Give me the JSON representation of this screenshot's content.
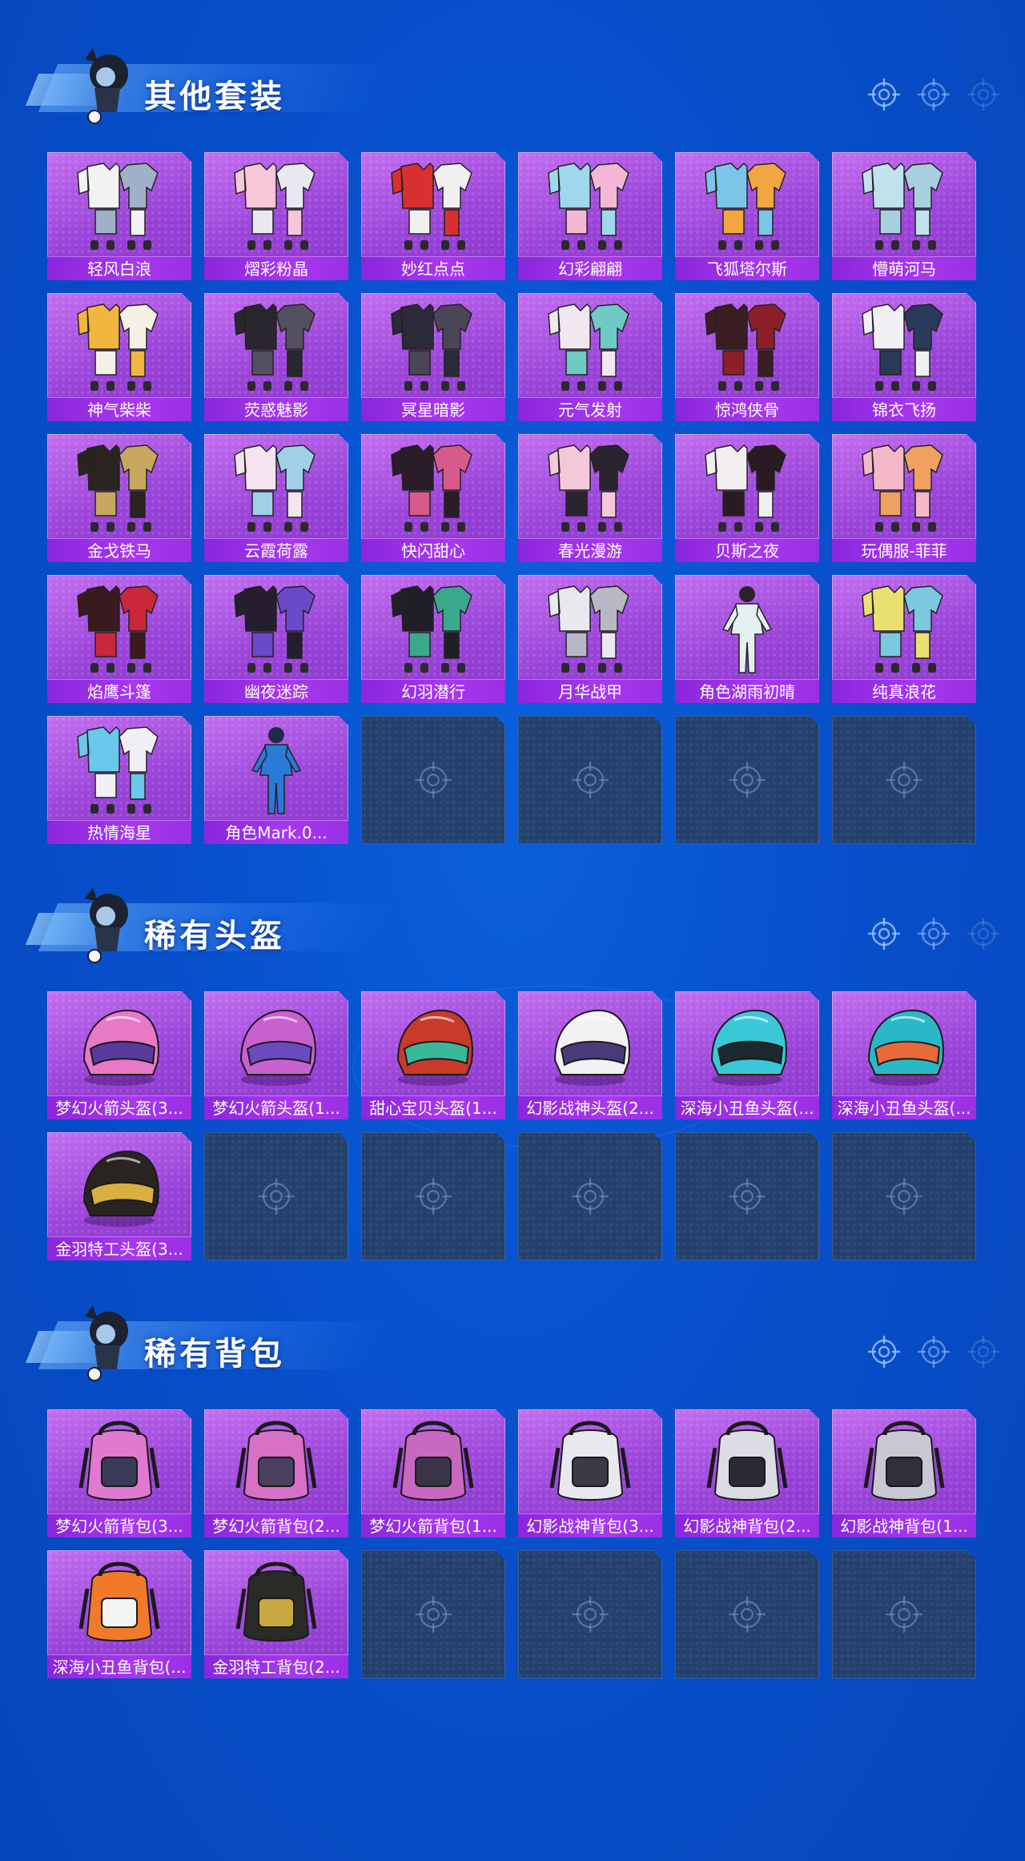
{
  "sections": [
    {
      "title": "其他套装",
      "icon": "suit-icon",
      "items": [
        {
          "name": "轻风白浪",
          "kind": "outfit",
          "colors": [
            "#f2f2f2",
            "#9fb0c8"
          ]
        },
        {
          "name": "熠彩粉晶",
          "kind": "outfit",
          "colors": [
            "#f7c6d9",
            "#e8e8f0"
          ]
        },
        {
          "name": "妙红点点",
          "kind": "outfit",
          "colors": [
            "#d83030",
            "#f0f0f0"
          ]
        },
        {
          "name": "幻彩翩翩",
          "kind": "outfit",
          "colors": [
            "#9fd8ec",
            "#f4b7d6"
          ]
        },
        {
          "name": "飞狐塔尔斯",
          "kind": "outfit",
          "colors": [
            "#7cc4e8",
            "#f2a640"
          ]
        },
        {
          "name": "懵萌河马",
          "kind": "outfit",
          "colors": [
            "#bfe2ec",
            "#a8cfe0"
          ]
        },
        {
          "name": "神气柴柴",
          "kind": "outfit",
          "colors": [
            "#f2b640",
            "#f4f0e6"
          ]
        },
        {
          "name": "荧惑魅影",
          "kind": "outfit",
          "colors": [
            "#2a2630",
            "#555060"
          ]
        },
        {
          "name": "冥星暗影",
          "kind": "outfit",
          "colors": [
            "#2c2a38",
            "#4a4658"
          ]
        },
        {
          "name": "元气发射",
          "kind": "outfit",
          "colors": [
            "#f0e8ee",
            "#6fc9c4"
          ]
        },
        {
          "name": "惊鸿侠骨",
          "kind": "outfit",
          "colors": [
            "#3a1e24",
            "#8a1f2a"
          ]
        },
        {
          "name": "锦衣飞扬",
          "kind": "outfit",
          "colors": [
            "#f0f0f4",
            "#2a3a5a"
          ]
        },
        {
          "name": "金戈铁马",
          "kind": "outfit",
          "colors": [
            "#2a2420",
            "#c8a860"
          ]
        },
        {
          "name": "云霞荷露",
          "kind": "outfit",
          "colors": [
            "#f3e4f0",
            "#9fd0e8"
          ]
        },
        {
          "name": "快闪甜心",
          "kind": "outfit",
          "colors": [
            "#2a1c28",
            "#d65a8a"
          ]
        },
        {
          "name": "春光漫游",
          "kind": "outfit",
          "colors": [
            "#f4c8d8",
            "#2a2430"
          ]
        },
        {
          "name": "贝斯之夜",
          "kind": "outfit",
          "colors": [
            "#f2eef0",
            "#2a1a22"
          ]
        },
        {
          "name": "玩偶服-菲菲",
          "kind": "outfit",
          "colors": [
            "#f4b8c8",
            "#f0a060"
          ]
        },
        {
          "name": "焰鹰斗篷",
          "kind": "outfit",
          "colors": [
            "#3a1a1e",
            "#c8283a"
          ]
        },
        {
          "name": "幽夜迷踪",
          "kind": "outfit",
          "colors": [
            "#241e30",
            "#6a4ac8"
          ]
        },
        {
          "name": "幻羽潜行",
          "kind": "outfit",
          "colors": [
            "#221e28",
            "#3aa88a"
          ]
        },
        {
          "name": "月华战甲",
          "kind": "outfit",
          "colors": [
            "#e8e8ee",
            "#b8b8c4"
          ]
        },
        {
          "name": "角色湖雨初晴",
          "kind": "figure",
          "colors": [
            "#e4f0f0",
            "#2a2428"
          ]
        },
        {
          "name": "纯真浪花",
          "kind": "outfit",
          "colors": [
            "#e8e070",
            "#7cc8e0"
          ]
        },
        {
          "name": "热情海星",
          "kind": "outfit",
          "colors": [
            "#6ac8ec",
            "#f0f0f4"
          ]
        },
        {
          "name": "角色Mark.0...",
          "kind": "figure",
          "colors": [
            "#2a7ad8",
            "#1e2a4a"
          ]
        }
      ],
      "empty_slots": 4
    },
    {
      "title": "稀有头盔",
      "icon": "helmet-icon",
      "items": [
        {
          "name": "梦幻火箭头盔(3...",
          "kind": "helmet",
          "colors": [
            "#e878c8",
            "#5a3a9a"
          ]
        },
        {
          "name": "梦幻火箭头盔(1...",
          "kind": "helmet",
          "colors": [
            "#c860d0",
            "#6a4ac0"
          ]
        },
        {
          "name": "甜心宝贝头盔(1...",
          "kind": "helmet",
          "colors": [
            "#c83a2a",
            "#3ab89a"
          ]
        },
        {
          "name": "幻影战神头盔(2...",
          "kind": "helmet",
          "colors": [
            "#f2f2f4",
            "#4a3a7a"
          ]
        },
        {
          "name": "深海小丑鱼头盔(...",
          "kind": "helmet",
          "colors": [
            "#3ac8d8",
            "#1a2a30"
          ]
        },
        {
          "name": "深海小丑鱼头盔(...",
          "kind": "helmet",
          "colors": [
            "#2ab8c8",
            "#e86a3a"
          ]
        },
        {
          "name": "金羽特工头盔(3...",
          "kind": "helmet",
          "colors": [
            "#2a2420",
            "#d8b040"
          ]
        }
      ],
      "empty_slots": 5
    },
    {
      "title": "稀有背包",
      "icon": "backpack-icon",
      "items": [
        {
          "name": "梦幻火箭背包(3...",
          "kind": "backpack",
          "colors": [
            "#e07ad0",
            "#3a3a5a"
          ]
        },
        {
          "name": "梦幻火箭背包(2...",
          "kind": "backpack",
          "colors": [
            "#d870c8",
            "#4a4060"
          ]
        },
        {
          "name": "梦幻火箭背包(1...",
          "kind": "backpack",
          "colors": [
            "#c868c0",
            "#3a3448"
          ]
        },
        {
          "name": "幻影战神背包(3...",
          "kind": "backpack",
          "colors": [
            "#e8e8ee",
            "#3a3a48"
          ]
        },
        {
          "name": "幻影战神背包(2...",
          "kind": "backpack",
          "colors": [
            "#dcdce4",
            "#2a2a34"
          ]
        },
        {
          "name": "幻影战神背包(1...",
          "kind": "backpack",
          "colors": [
            "#c8c8d4",
            "#30303a"
          ]
        },
        {
          "name": "深海小丑鱼背包(...",
          "kind": "backpack",
          "colors": [
            "#f07a2a",
            "#f4f4f4"
          ]
        },
        {
          "name": "金羽特工背包(2...",
          "kind": "backpack",
          "colors": [
            "#2a2a26",
            "#c8a840"
          ]
        }
      ],
      "empty_slots": 4
    }
  ]
}
